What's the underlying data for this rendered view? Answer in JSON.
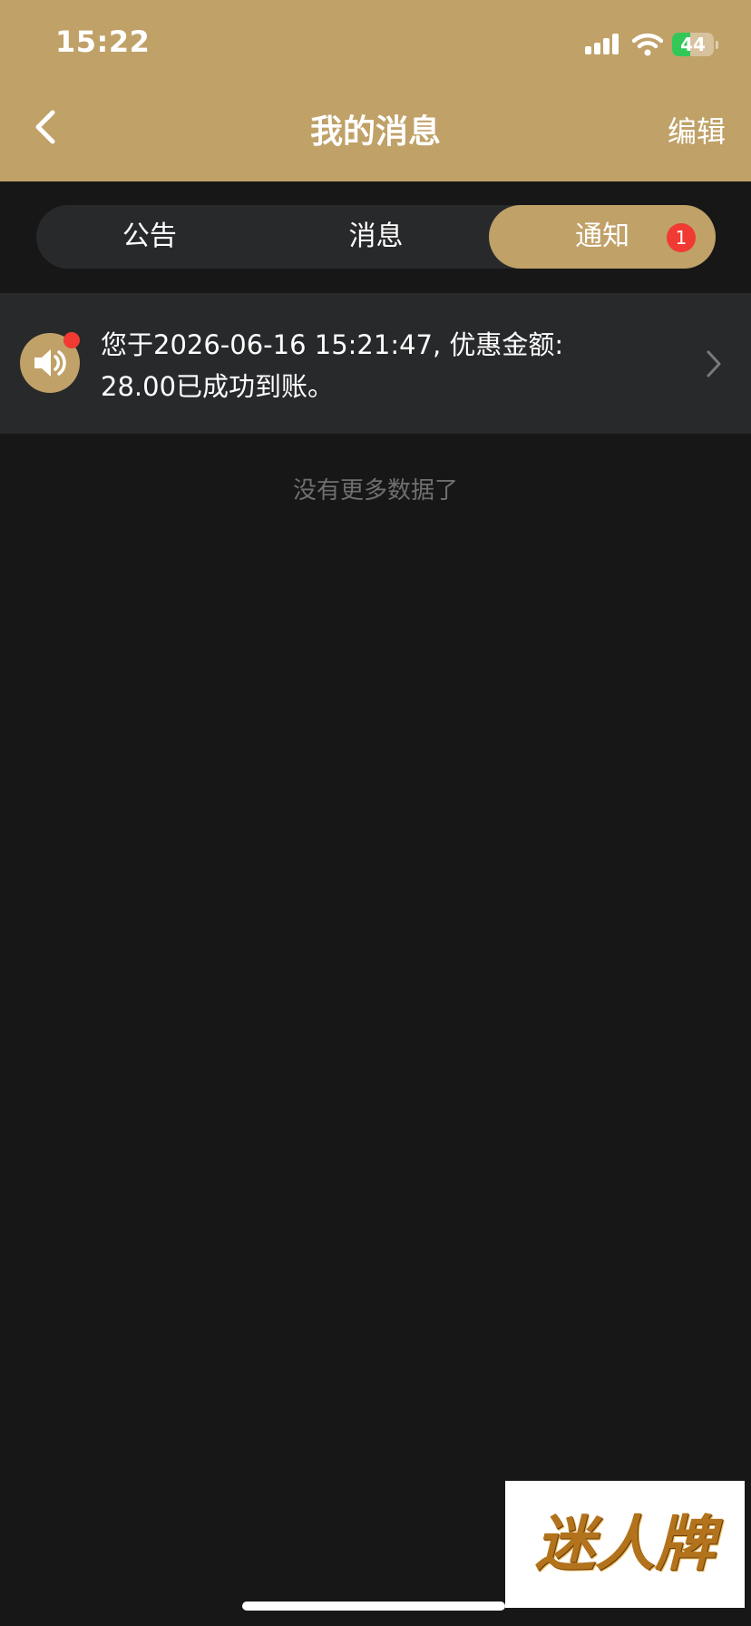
{
  "status_bar": {
    "time": "15:22",
    "battery_level": "44",
    "icons": [
      "signal-icon",
      "wifi-icon",
      "battery-charging-icon"
    ]
  },
  "nav": {
    "title": "我的消息",
    "edit_label": "编辑",
    "back_icon": "chevron-left-icon"
  },
  "tabs": [
    {
      "label": "公告",
      "active": false
    },
    {
      "label": "消息",
      "active": false
    },
    {
      "label": "通知",
      "active": true,
      "badge": "1"
    }
  ],
  "notifications": [
    {
      "icon": "speaker-icon",
      "unread": true,
      "text": "您于2026-06-16 15:21:47, 优惠金额: 28.00已成功到账。"
    }
  ],
  "footer": {
    "no_more_text": "没有更多数据了"
  },
  "watermark": {
    "text": "迷人牌"
  },
  "colors": {
    "accent": "#c0a168",
    "background": "#171717",
    "row_background": "#28292b",
    "badge": "#f03a32"
  }
}
